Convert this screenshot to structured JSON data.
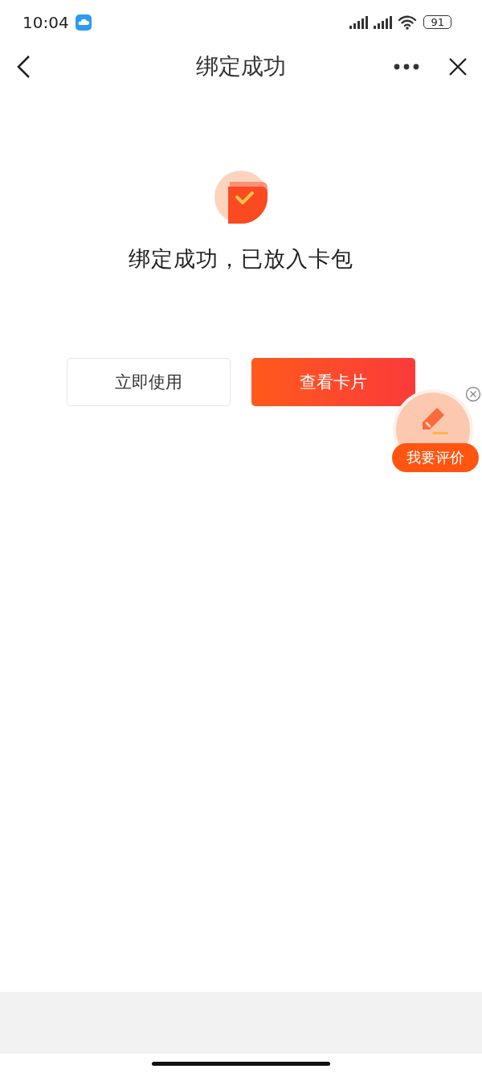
{
  "status_bar": {
    "time": "10:04",
    "battery": "91"
  },
  "nav": {
    "title": "绑定成功"
  },
  "result": {
    "message": "绑定成功，已放入卡包"
  },
  "buttons": [
    {
      "label": "立即使用",
      "kind": "secondary"
    },
    {
      "label": "查看卡片",
      "kind": "primary"
    }
  ],
  "feedback": {
    "label": "我要评价"
  }
}
